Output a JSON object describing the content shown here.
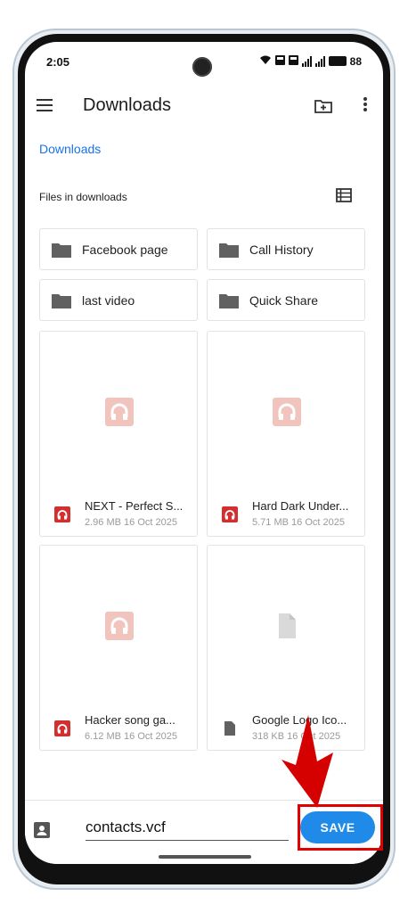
{
  "status_bar": {
    "time": "2:05",
    "battery": "88",
    "icons": [
      "wifi-icon",
      "volte1-icon",
      "volte2-icon",
      "signal1-icon",
      "signal2-icon",
      "battery-icon"
    ]
  },
  "app_bar": {
    "title": "Downloads",
    "icons": [
      "menu-icon",
      "new-folder-icon",
      "more-vert-icon"
    ]
  },
  "breadcrumb": "Downloads",
  "section_label": "Files in downloads",
  "folders": [
    {
      "name": "Facebook page"
    },
    {
      "name": "Call History"
    },
    {
      "name": "last video"
    },
    {
      "name": "Quick Share"
    }
  ],
  "files": [
    {
      "name": "NEXT - Perfect S...",
      "meta": "2.96 MB 16 Oct 2025",
      "type": "audio"
    },
    {
      "name": "Hard Dark Under...",
      "meta": "5.71 MB 16 Oct 2025",
      "type": "audio"
    },
    {
      "name": "Hacker song  ga...",
      "meta": "6.12 MB 16 Oct 2025",
      "type": "audio"
    },
    {
      "name": "Google Logo Ico...",
      "meta": "318 KB 16 Oct 2025",
      "type": "document"
    }
  ],
  "bottom": {
    "filename": "contacts.vcf",
    "save_label": "SAVE"
  },
  "colors": {
    "accent": "#1f8ae8",
    "audio_icon": "#d32f2f",
    "audio_thumb": "#f2c4be",
    "annotation": "#e00000"
  }
}
